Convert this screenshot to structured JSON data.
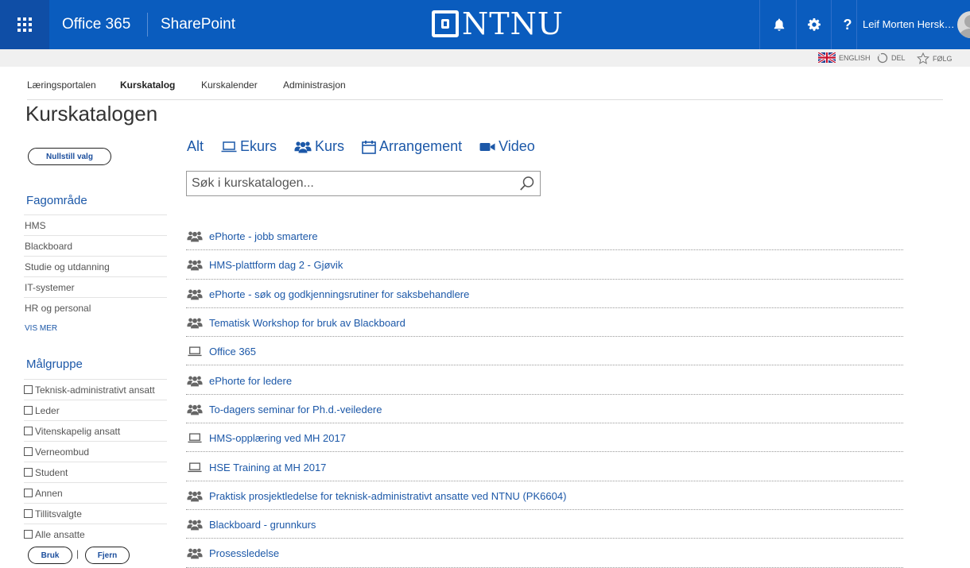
{
  "suitebar": {
    "app_launcher_icon": "waffle-grid-icon",
    "office_label": "Office 365",
    "sharepoint_label": "SharePoint",
    "logo_text": "NTNU",
    "notification_icon": "bell-icon",
    "settings_icon": "gear-icon",
    "help_label": "?",
    "user_name": "Leif Morten Hersk…",
    "colors": {
      "background": "#0a5cbe",
      "waffle_background": "#0f4ea6"
    }
  },
  "ribbon": {
    "language_label": "ENGLISH",
    "language_icon": "uk-flag-icon",
    "share_label": "DEL",
    "share_icon": "share-icon",
    "follow_label": "FØLG",
    "follow_icon": "star-icon"
  },
  "topnav": {
    "items": [
      {
        "label": "Læringsportalen",
        "active": false
      },
      {
        "label": "Kurskatalog",
        "active": true
      },
      {
        "label": "Kurskalender",
        "active": false
      },
      {
        "label": "Administrasjon",
        "active": false
      }
    ]
  },
  "page": {
    "title": "Kurskatalogen"
  },
  "sidebar": {
    "reset_label": "Nullstill valg",
    "fagomrade": {
      "title": "Fagområde",
      "items": [
        "HMS",
        "Blackboard",
        "Studie og utdanning",
        "IT-systemer",
        "HR og personal"
      ],
      "more_label": "VIS MER"
    },
    "malgruppe": {
      "title": "Målgruppe",
      "items": [
        {
          "label": "Teknisk-administrativt ansatt",
          "checked": false
        },
        {
          "label": "Leder",
          "checked": false
        },
        {
          "label": "Vitenskapelig ansatt",
          "checked": false
        },
        {
          "label": "Verneombud",
          "checked": false
        },
        {
          "label": "Student",
          "checked": false
        },
        {
          "label": "Annen",
          "checked": false
        },
        {
          "label": "Tillitsvalgte",
          "checked": false
        },
        {
          "label": "Alle ansatte",
          "checked": false
        }
      ]
    },
    "apply_label": "Bruk",
    "separator": "|",
    "remove_label": "Fjern"
  },
  "type_tabs": [
    {
      "label": "Alt",
      "icon": ""
    },
    {
      "label": "Ekurs",
      "icon": "laptop-icon"
    },
    {
      "label": "Kurs",
      "icon": "group-icon"
    },
    {
      "label": "Arrangement",
      "icon": "calendar-icon"
    },
    {
      "label": "Video",
      "icon": "video-camera-icon"
    }
  ],
  "search": {
    "placeholder": "Søk i kurskatalogen...",
    "value": "",
    "icon": "search-icon"
  },
  "courses": [
    {
      "title": "ePhorte - jobb smartere",
      "icon": "group-icon"
    },
    {
      "title": "HMS-plattform dag 2 - Gjøvik",
      "icon": "group-icon"
    },
    {
      "title": "ePhorte - søk og godkjenningsrutiner for saksbehandlere",
      "icon": "group-icon"
    },
    {
      "title": "Tematisk Workshop for bruk av Blackboard",
      "icon": "group-icon"
    },
    {
      "title": "Office 365",
      "icon": "laptop-icon"
    },
    {
      "title": "ePhorte for ledere",
      "icon": "group-icon"
    },
    {
      "title": "To-dagers seminar for Ph.d.-veiledere",
      "icon": "group-icon"
    },
    {
      "title": "HMS-opplæring ved MH 2017",
      "icon": "laptop-icon"
    },
    {
      "title": "HSE Training at MH 2017",
      "icon": "laptop-icon"
    },
    {
      "title": "Praktisk prosjektledelse for teknisk-administrativt ansatte ved NTNU (PK6604)",
      "icon": "group-icon"
    },
    {
      "title": "Blackboard - grunnkurs",
      "icon": "group-icon"
    },
    {
      "title": "Prosessledelse",
      "icon": "group-icon"
    }
  ],
  "colors": {
    "link": "#1c58a8",
    "text": "#444444"
  }
}
